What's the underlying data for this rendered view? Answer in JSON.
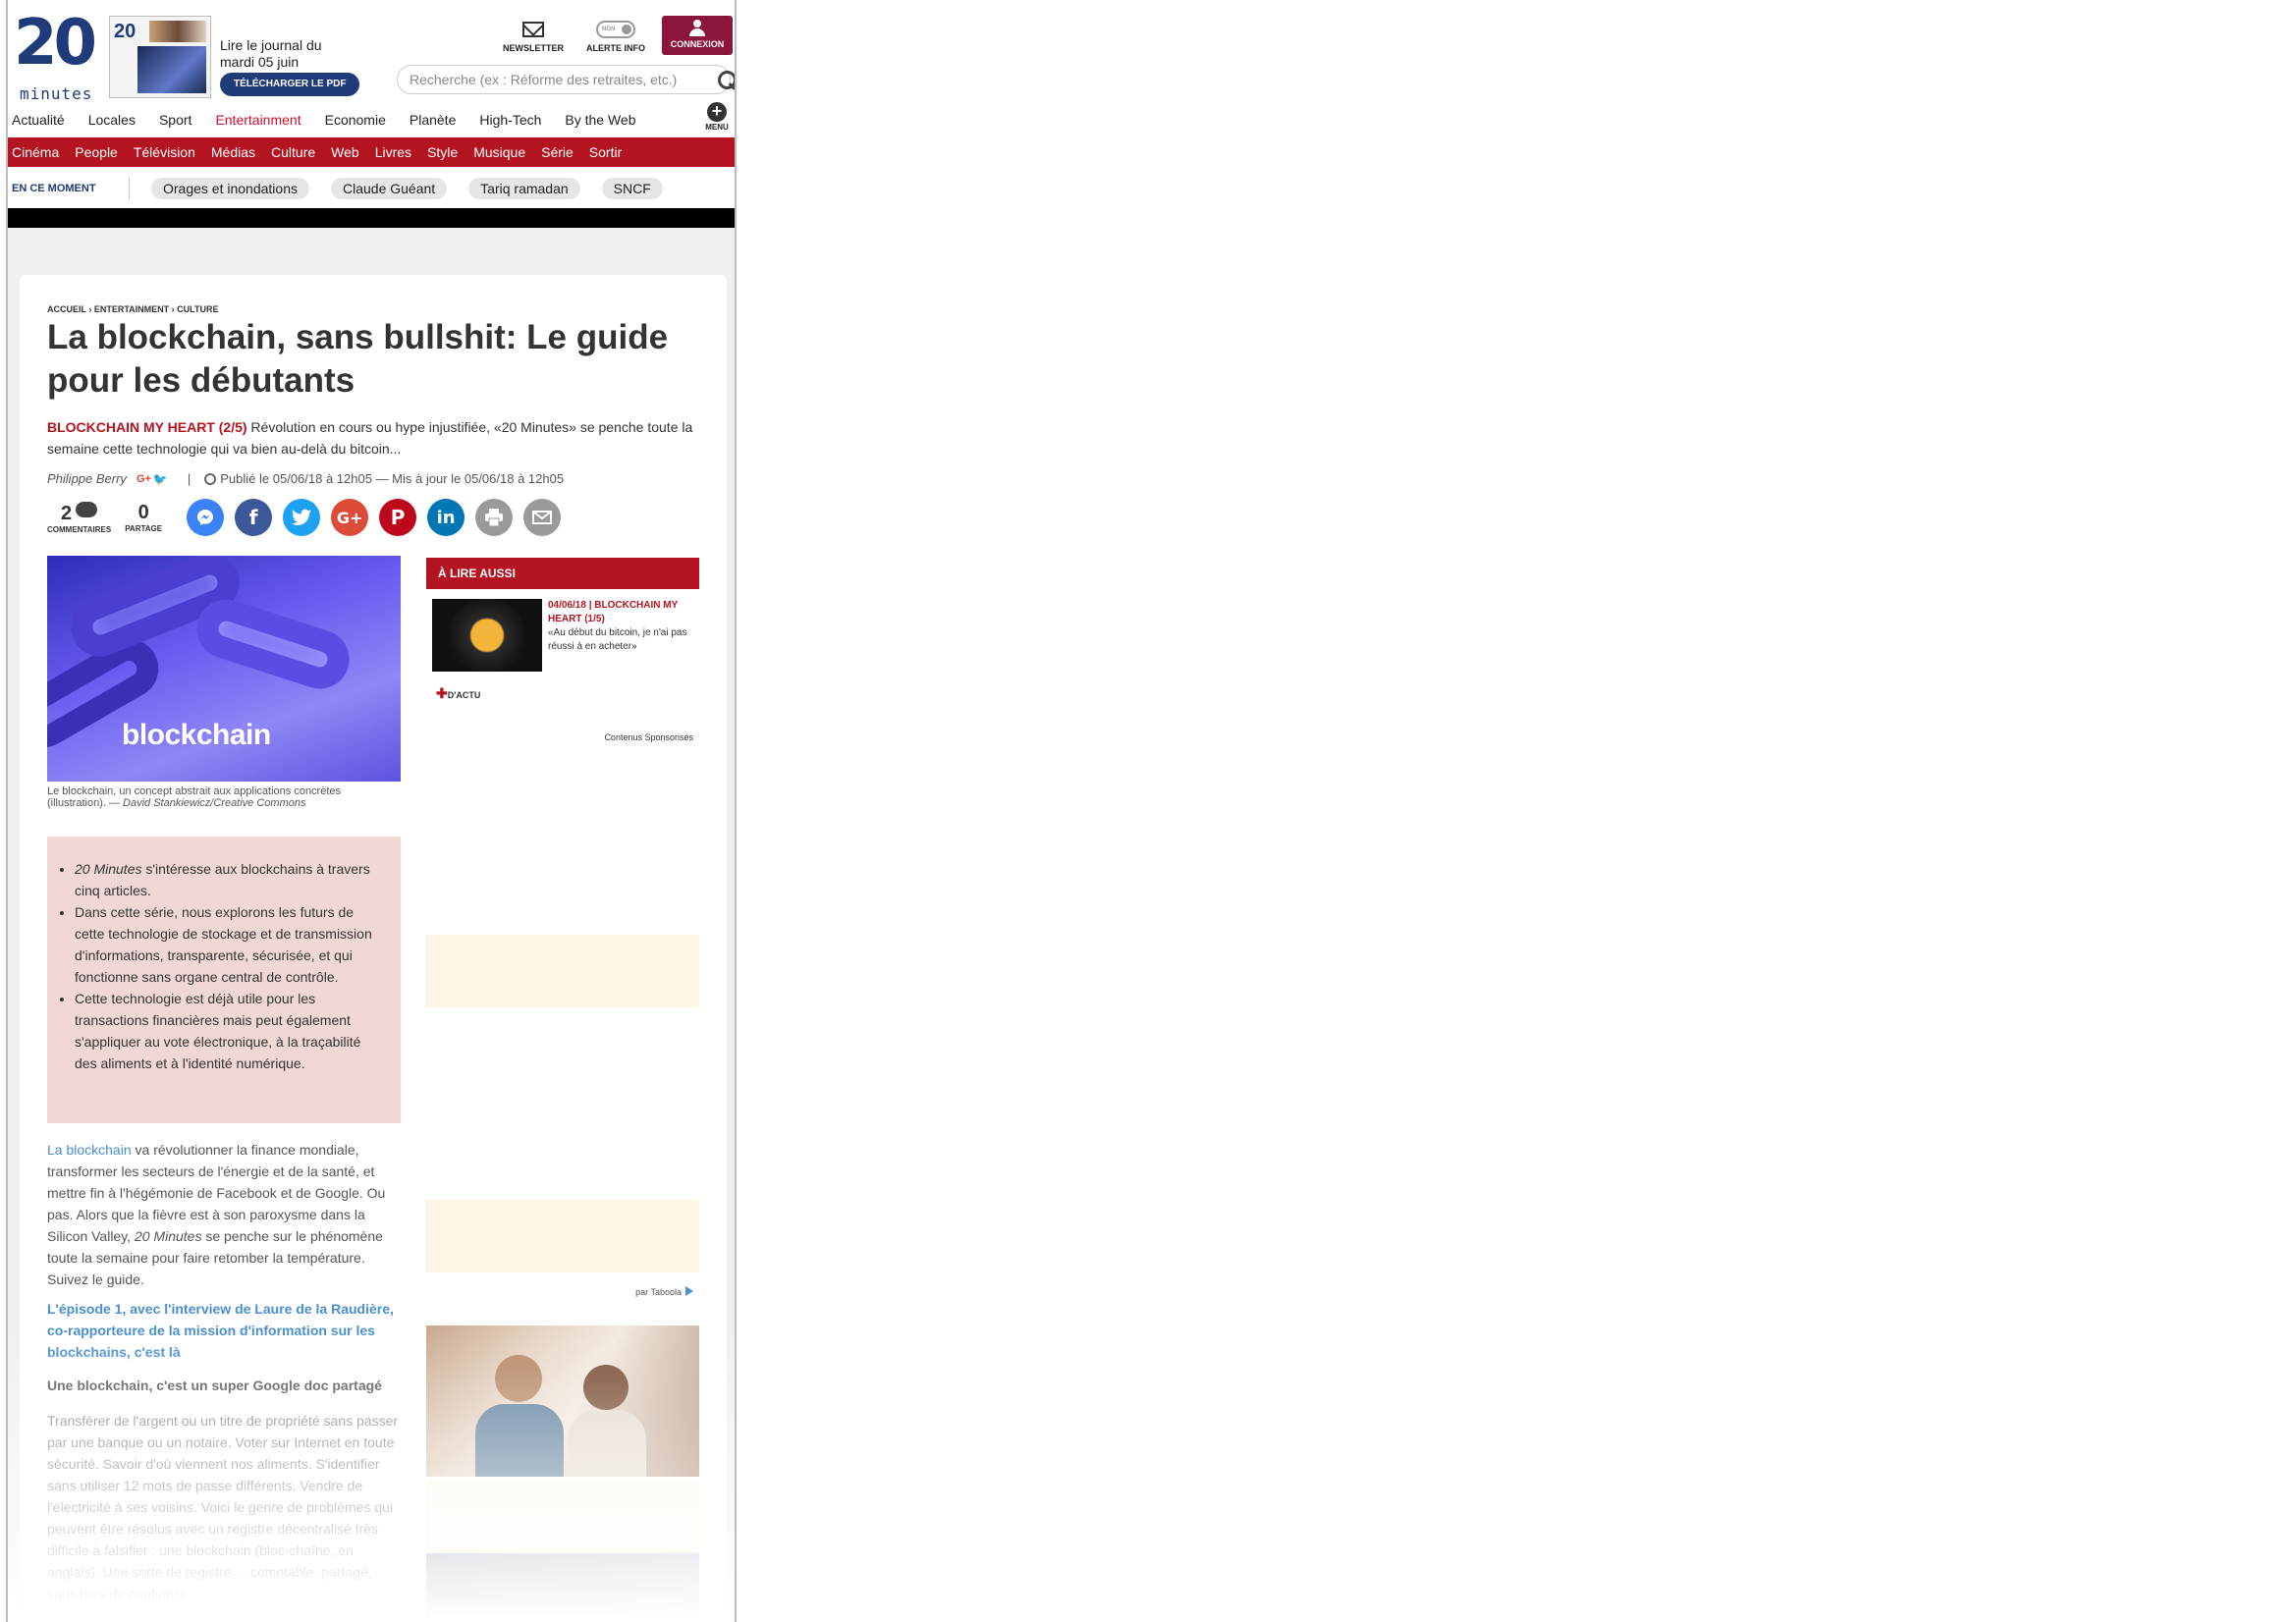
{
  "header": {
    "logo_number": "20",
    "logo_word": "minutes",
    "paper_thumb_label": "20",
    "journal_line1": "Lire le journal du",
    "journal_line2": "mardi 05 juin",
    "pdf_button": "TÉLÉCHARGER LE PDF",
    "newsletter": "NEWSLETTER",
    "alerte_toggle": "NON",
    "alerte": "ALERTE INFO",
    "connexion": "CONNEXION",
    "search_placeholder": "Recherche (ex : Réforme des retraites, etc.)",
    "menu_label": "MENU"
  },
  "main_nav": [
    "Actualité",
    "Locales",
    "Sport",
    "Entertainment",
    "Economie",
    "Planète",
    "High-Tech",
    "By the Web"
  ],
  "active_main_nav": "Entertainment",
  "sub_nav": [
    "Cinéma",
    "People",
    "Télévision",
    "Médias",
    "Culture",
    "Web",
    "Livres",
    "Style",
    "Musique",
    "Série",
    "Sortir"
  ],
  "moment": {
    "label": "EN CE MOMENT",
    "chips": [
      "Orages et inondations",
      "Claude Guéant",
      "Tariq ramadan",
      "SNCF"
    ]
  },
  "article": {
    "breadcrumb": "ACCUEIL › ENTERTAINMENT › CULTURE",
    "title": "La blockchain, sans bullshit: Le guide pour les débutants",
    "lead_tag": "BLOCKCHAIN MY HEART (2/5)",
    "lead_text": " Révolution en cours ou hype injustifiée, «20 Minutes» se penche toute la semaine cette technologie qui va bien au-delà du bitcoin...",
    "author": "Philippe Berry",
    "author_gplus": "G+",
    "author_twitter": "🐦",
    "separator": "|",
    "published": "Publié le 05/06/18 à 12h05 — Mis à jour le 05/06/18 à 12h05",
    "comments_count": "2",
    "comments_label": "COMMENTAIRES",
    "shares_count": "0",
    "shares_label": "PARTAGE",
    "hero_word": "blockchain",
    "caption_text": "Le blockchain, un concept abstrait aux applications concrètes (illustration). — ",
    "caption_credit": "David Stankiewicz/Creative Commons",
    "summary": [
      {
        "em": "20 Minutes",
        "text": " s'intéresse aux blockchains à travers cinq articles."
      },
      {
        "em": "",
        "text": "Dans cette série, nous explorons les futurs de cette technologie de stockage et de transmission d'informations, transparente, sécurisée, et qui fonctionne sans organe central de contrôle."
      },
      {
        "em": "",
        "text": "Cette technologie est déjà utile pour les transactions financières mais peut également s'appliquer au vote électronique, à la traçabilité des aliments et à l'identité numérique."
      }
    ],
    "body_link": "La blockchain",
    "body_p1_a": " va révolutionner la finance mondiale, transformer les secteurs de l'énergie et de la santé, et mettre fin à l'hégémonie de Facebook et de Google. Ou pas. Alors que la fièvre est à son paroxysme dans la Silicon Valley, ",
    "body_p1_em": "20 Minutes",
    "body_p1_b": " se penche sur le phénomène toute la semaine pour faire retomber la température. Suivez le guide.",
    "episode_link": "L'épisode 1, avec l'interview de Laure de la Raudière, co-rapporteure de la mission d'information sur les blockchains, c'est là",
    "subhead": "Une blockchain, c'est un super Google doc partagé",
    "body_p2": "Transférer de l'argent ou un titre de propriété sans passer par une banque ou un notaire. Voter sur Internet en toute sécurité. Savoir d'où viennent nos aliments. S'identifier sans utiliser 12 mots de passe différents. Vendre de l'électricité à ses voisins. Voici le genre de problèmes qui peuvent être résolus avec un registre décentralisé très difficile à falsifier : une blockchain (bloc-chaîne, en anglais). Une sorte de registre ... comptable, partagé, sans tiers de confiance."
  },
  "aside": {
    "head": "À LIRE AUSSI",
    "item_date": "04/06/18 | BLOCKCHAIN MY HEART (1/5)",
    "item_text": "«Au début du bitcoin, je n'ai pas réussi à en acheter»",
    "dactu_plus": "✚",
    "dactu": "D'ACTU",
    "sponso": "Contenus Sponsorisés",
    "taboola": "par Taboola"
  },
  "colors": {
    "brand_blue": "#1f3b7a",
    "brand_red": "#b3141f",
    "connexion_bg": "#8a1538",
    "summary_bg": "#f1d8d7"
  }
}
